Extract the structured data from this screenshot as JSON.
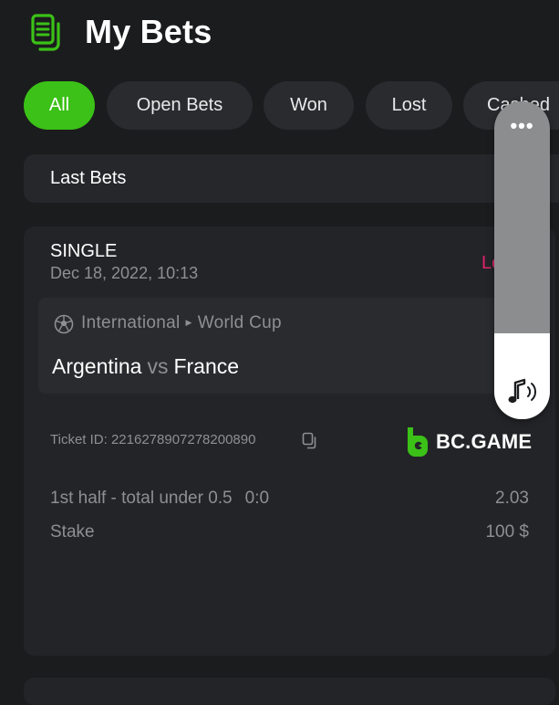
{
  "header": {
    "title": "My Bets",
    "icon": "bets-document-icon"
  },
  "filters": [
    {
      "label": "All",
      "active": true
    },
    {
      "label": "Open Bets",
      "active": false
    },
    {
      "label": "Won",
      "active": false
    },
    {
      "label": "Lost",
      "active": false
    },
    {
      "label": "Cashed",
      "active": false
    }
  ],
  "section": {
    "label": "Last Bets"
  },
  "bet": {
    "type": "SINGLE",
    "date": "Dec 18, 2022, 10:13",
    "status": "Lost",
    "league": {
      "category": "International",
      "competition": "World Cup",
      "icon": "soccer-ball-icon"
    },
    "teams": {
      "home": "Argentina",
      "vs": "vs",
      "away": "France"
    },
    "ticket": "Ticket ID: 2216278907278200890",
    "brand": "BC.GAME",
    "selection": {
      "market": "1st half - total under 0.5",
      "score": "0:0",
      "odds": "2.03"
    },
    "stake": {
      "label": "Stake",
      "value": "100 $"
    }
  },
  "volume_overlay": {
    "more_label": "•••",
    "level": 0.27,
    "icon": "music-note-icon"
  },
  "colors": {
    "background": "#1b1c1e",
    "card": "#232427",
    "accent": "#3bc117",
    "lost": "#e0226e",
    "muted": "#8e8f93"
  }
}
